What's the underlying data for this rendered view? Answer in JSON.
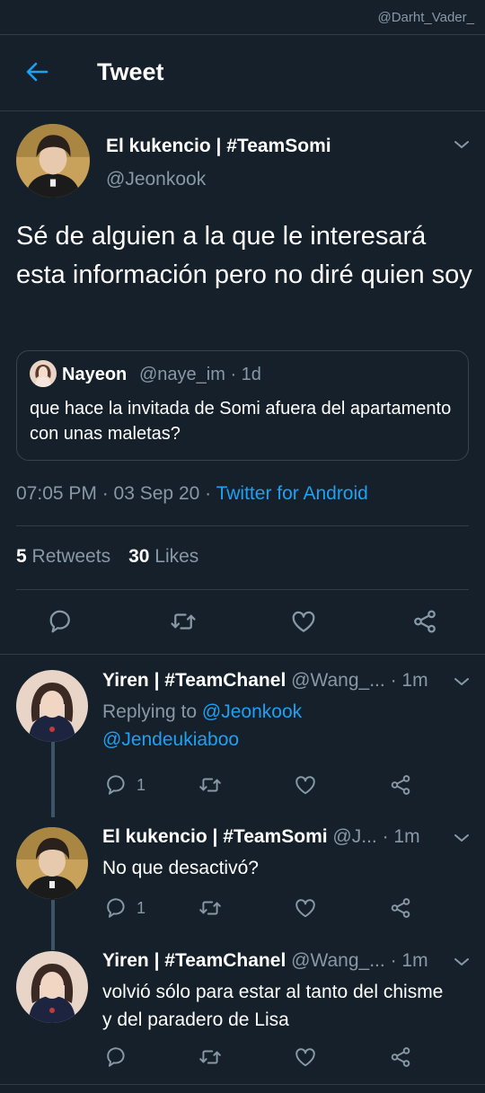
{
  "watermark": "@Darht_Vader_",
  "header": {
    "title": "Tweet"
  },
  "tweet": {
    "author_name": "El kukencio | #TeamSomi",
    "author_handle": "@Jeonkook",
    "text": "Sé de alguien a la que le interesará esta información pero no diré quien soy",
    "quote": {
      "name": "Nayeon",
      "meta": "@naye_im · 1d",
      "text": "que hace la invitada de Somi afuera del apartamento con unas maletas?"
    },
    "time": "07:05 PM · 03 Sep 20 · ",
    "source": "Twitter for Android",
    "retweets": "5",
    "retweets_label": "Retweets",
    "likes": "30",
    "likes_label": "Likes"
  },
  "replies": [
    {
      "name": "Yiren | #TeamChanel",
      "handle": "@Wang_...",
      "time": "· 1m",
      "replying_label": "Replying to ",
      "replying_to_1": "@Jeonkook",
      "replying_to_2": "@Jendeukiaboo",
      "reply_count": "1"
    },
    {
      "name": "El kukencio | #TeamSomi",
      "handle": "@J...",
      "time": "· 1m",
      "text": "No que desactivó?",
      "reply_count": "1"
    },
    {
      "name": "Yiren | #TeamChanel",
      "handle": "@Wang_...",
      "time": "· 1m",
      "text": "volvió sólo para estar al tanto del chisme y del paradero de Lisa"
    }
  ],
  "colors": {
    "background": "#15202b",
    "accent": "#1da1f2",
    "muted": "#8899a6",
    "divider": "#2f3b47"
  },
  "icons": [
    "back-arrow-icon",
    "chevron-down-icon",
    "reply-icon",
    "retweet-icon",
    "like-icon",
    "share-icon"
  ]
}
